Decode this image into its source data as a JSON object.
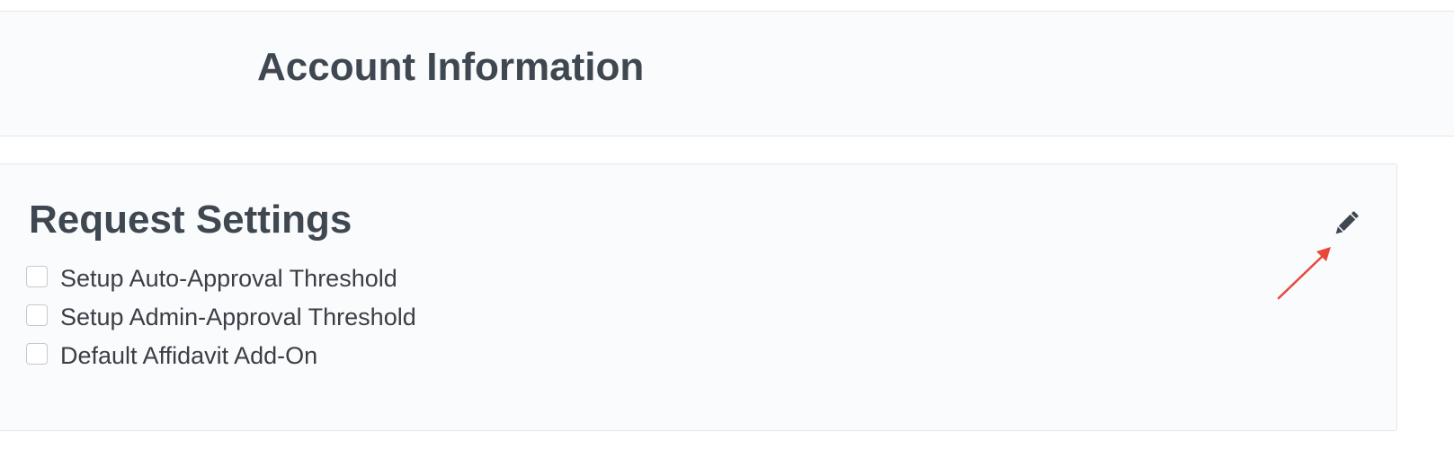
{
  "header": {
    "title": "Account Information"
  },
  "request_settings": {
    "title": "Request Settings",
    "edit_icon": "pencil-icon",
    "options": [
      {
        "label": "Setup Auto-Approval Threshold",
        "checked": false
      },
      {
        "label": "Setup Admin-Approval Threshold",
        "checked": false
      },
      {
        "label": "Default Affidavit Add-On",
        "checked": false
      }
    ]
  },
  "colors": {
    "heading": "#3f4750",
    "panel_background": "#f9fbfd",
    "border": "#e4e7eb",
    "annotation_arrow": "#e8473a"
  }
}
